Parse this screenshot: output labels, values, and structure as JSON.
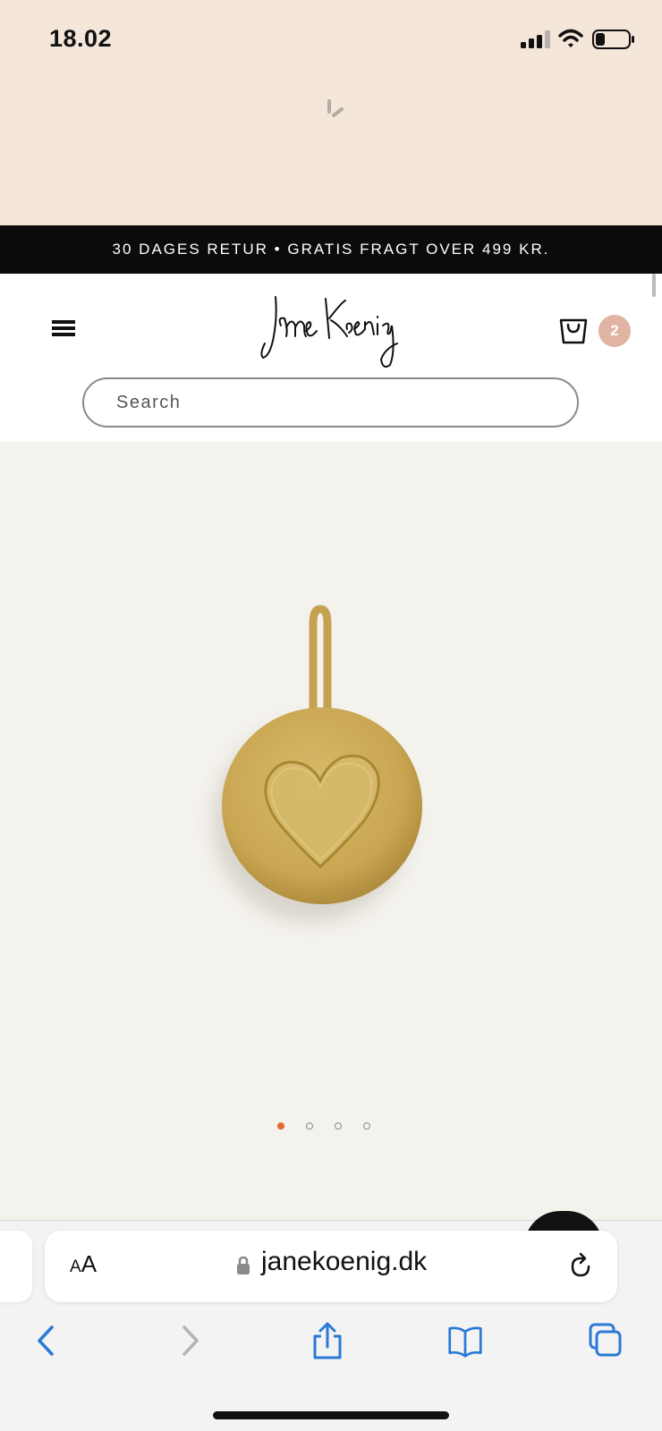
{
  "status_bar": {
    "time": "18.02",
    "icons": [
      "signal-icon",
      "wifi-icon",
      "battery-icon"
    ]
  },
  "loading": {
    "icon": "spinner-icon"
  },
  "promo": {
    "text": "30 DAGES RETUR • GRATIS FRAGT OVER 499 KR."
  },
  "header": {
    "menu_icon": "hamburger-menu-icon",
    "logo": "Jane Koenig",
    "cart_icon": "shopping-bag-icon",
    "cart_count": "2"
  },
  "search": {
    "placeholder": "Search",
    "value": ""
  },
  "product": {
    "image": "gold-heart-pendant",
    "carousel": {
      "total": 4,
      "active": 1
    }
  },
  "browser": {
    "text_size_label_small": "A",
    "text_size_label_large": "A",
    "url": "janekoenig.dk",
    "toolbar": [
      "back-icon",
      "forward-icon",
      "share-icon",
      "bookmarks-icon",
      "tabs-icon"
    ]
  },
  "colors": {
    "status_bg": "#f5e6da",
    "promo_bg": "#0b0b0b",
    "badge": "#e0b3a3",
    "dot_active": "#e2692f",
    "link_blue": "#2a7ad6"
  }
}
